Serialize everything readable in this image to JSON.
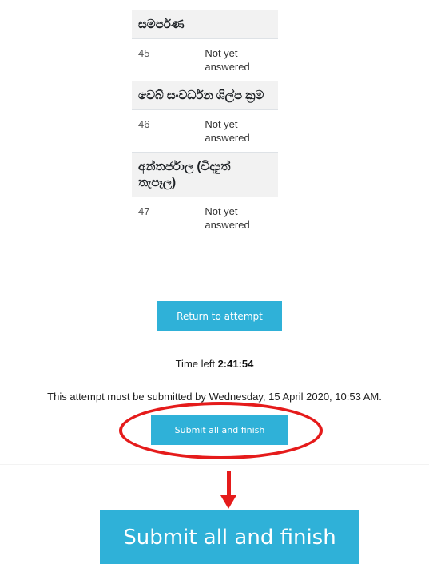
{
  "quiz_navigation": {
    "sections": [
      {
        "heading": "සමර්පණ",
        "question": {
          "number": "45",
          "status": "Not yet answered"
        }
      },
      {
        "heading": "වෙබ් සංවර්ධන ශිල්ප ක්‍රම",
        "question": {
          "number": "46",
          "status": "Not yet answered"
        }
      },
      {
        "heading": "අන්තර්ජාල (විද්‍යුත් තැපෑල)",
        "question": {
          "number": "47",
          "status": "Not yet answered"
        }
      }
    ]
  },
  "actions": {
    "return_label": "Return to attempt",
    "submit_label": "Submit all and finish"
  },
  "timer": {
    "label": "Time left",
    "value": "2:41:54"
  },
  "deadline": {
    "text": "This attempt must be submitted by Wednesday, 15 April 2020, 10:53 AM."
  },
  "zoom": {
    "submit_label": "Submit all and finish"
  },
  "colors": {
    "button_bg": "#2fb1d8",
    "annotation_red": "#e51b1b",
    "section_bg": "#f2f2f2"
  }
}
